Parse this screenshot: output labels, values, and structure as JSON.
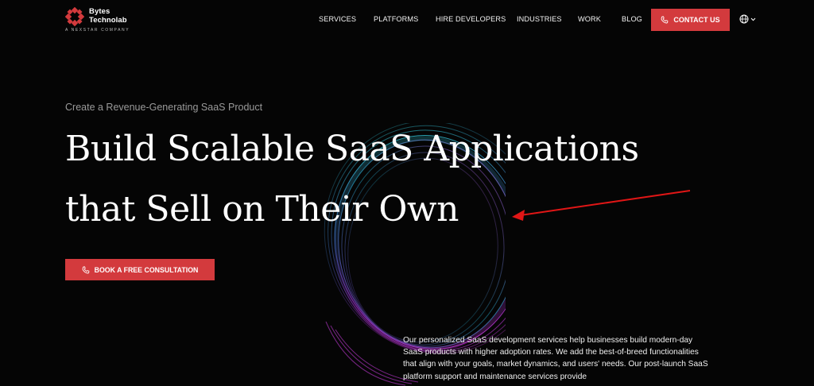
{
  "brand": {
    "name_line1": "Bytes",
    "name_line2": "Technolab",
    "tagline": "A NEXSTAR COMPANY",
    "accent_color": "#d33a3d"
  },
  "nav": {
    "items": [
      "SERVICES",
      "PLATFORMS",
      "HIRE DEVELOPERS",
      "INDUSTRIES",
      "WORK",
      "BLOG"
    ],
    "contact_label": "CONTACT US",
    "contact_icon": "phone-icon",
    "language_icon": "globe-icon"
  },
  "hero": {
    "eyebrow": "Create a Revenue-Generating SaaS Product",
    "headline_line1": "Build Scalable SaaS Applications",
    "headline_line2": "that Sell on Their Own",
    "cta_label": "BOOK A FREE CONSULTATION",
    "cta_icon": "phone-icon",
    "description": "Our personalized SaaS development services help businesses build modern-day SaaS products with higher adoption rates. We add the best-of-breed functionalities that align with your goals, market dynamics, and users' needs. Our post-launch SaaS platform support and maintenance services provide"
  },
  "annotation": {
    "arrow_color": "#e01616"
  }
}
